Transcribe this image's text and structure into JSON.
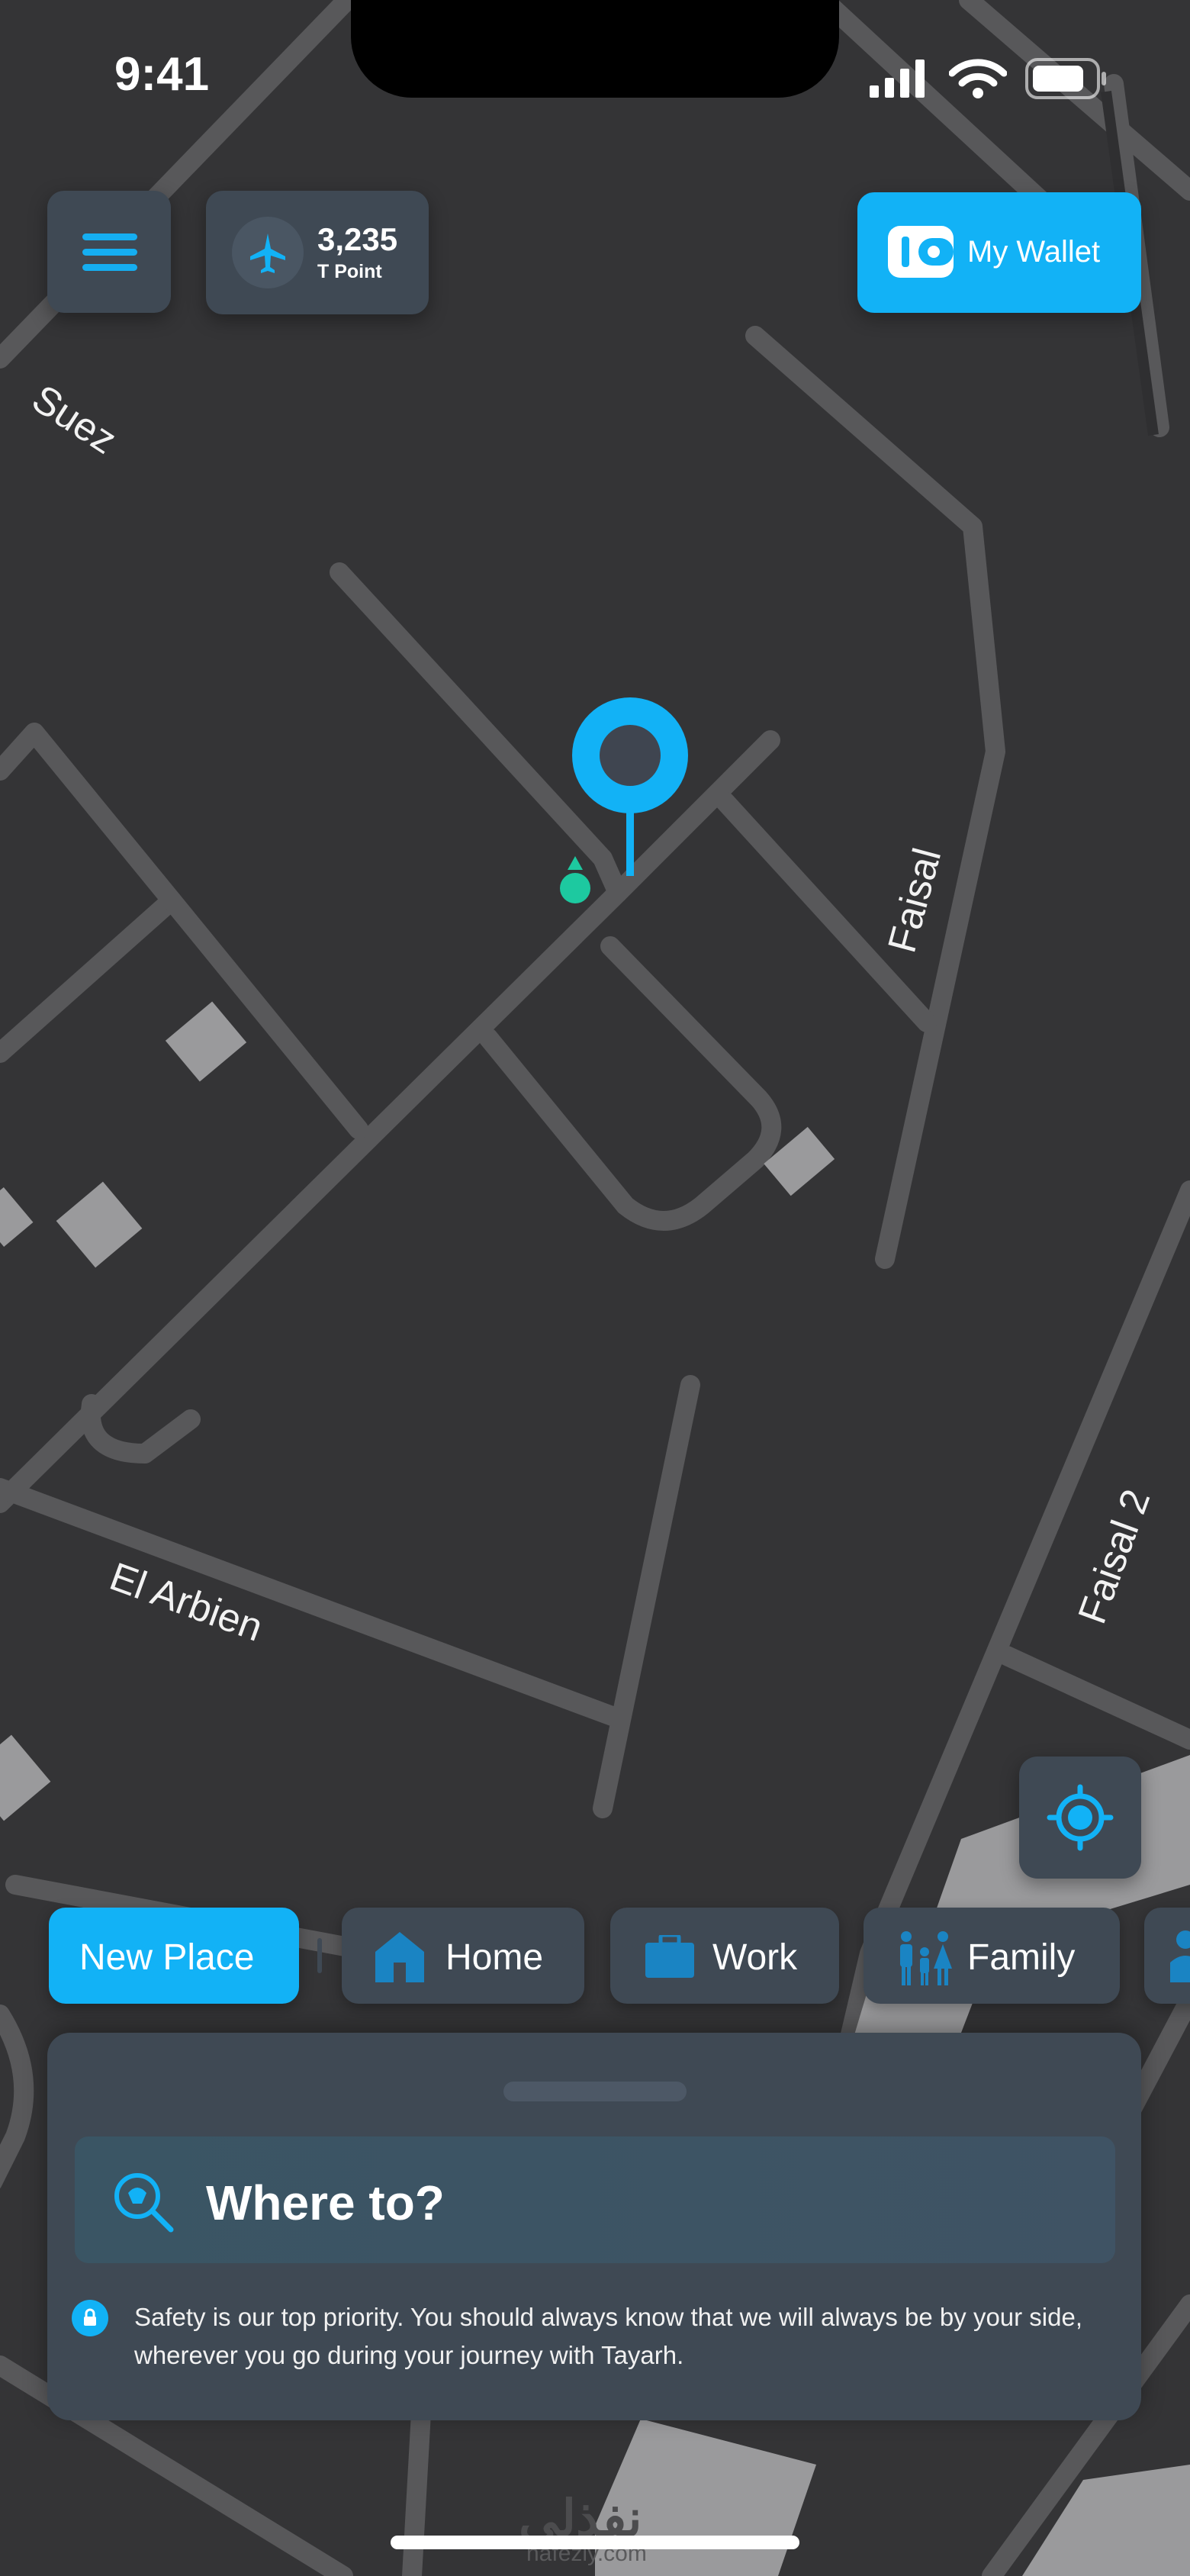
{
  "status_bar": {
    "time": "9:41"
  },
  "header": {
    "points_value": "3,235",
    "points_label": "T Point",
    "wallet_label": "My Wallet"
  },
  "map": {
    "streets": [
      "Suez",
      "Faisal",
      "El Arbien",
      "Faisal 2"
    ]
  },
  "chips": [
    {
      "label": "New Place",
      "active": true
    },
    {
      "label": "Home",
      "icon": "house-icon"
    },
    {
      "label": "Work",
      "icon": "briefcase-icon"
    },
    {
      "label": "Family",
      "icon": "family-icon"
    }
  ],
  "sheet": {
    "search_label": "Where to?",
    "safety_text": "Safety is our top priority. You should always know that we will always be by your side, wherever you go during your journey with Tayarh."
  },
  "watermark": {
    "arabic": "نفذلي",
    "latin": "nafezly.com"
  },
  "colors": {
    "accent": "#12b2f6",
    "card": "#3f4954",
    "map_bg": "#343436",
    "roads": "#58585a",
    "dot": "#1dc9a0"
  }
}
